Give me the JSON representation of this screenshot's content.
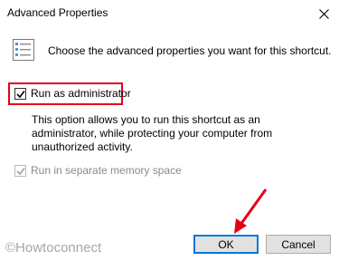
{
  "window": {
    "title": "Advanced Properties"
  },
  "header": {
    "icon": "shortcut-properties-icon",
    "text": "Choose the advanced properties you want for this shortcut."
  },
  "options": {
    "run_as_admin": {
      "label": "Run as administrator",
      "checked": true,
      "highlight_color": "#e3001b"
    },
    "description": "This option allows you to run this shortcut as an administrator, while protecting your computer from unauthorized activity.",
    "separate_memory": {
      "label": "Run in separate memory space",
      "checked": true,
      "enabled": false
    }
  },
  "buttons": {
    "ok": "OK",
    "cancel": "Cancel"
  },
  "watermark": "©Howtoconnect",
  "annotation": {
    "arrow_color": "#e3001b",
    "icon": "red-arrow-icon"
  },
  "colors": {
    "accent": "#0078d7",
    "button_bg": "#e1e1e1"
  }
}
